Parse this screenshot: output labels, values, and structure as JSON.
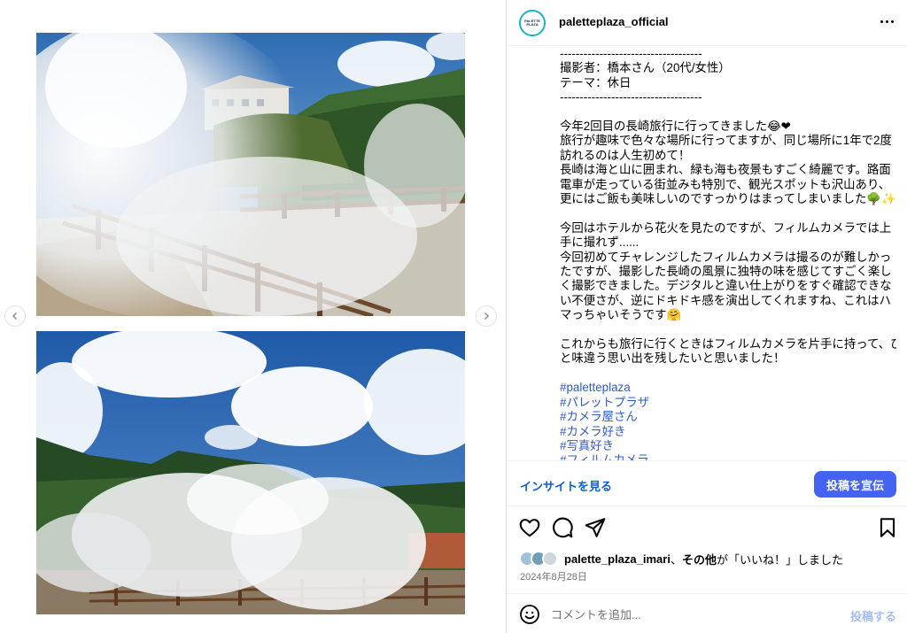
{
  "post": {
    "username": "paletteplaza_official",
    "avatar_text": "PALETTE PLAZA",
    "caption_lines": [
      "------------------------------------",
      "撮影者：橋本さん（20代/女性）",
      "テーマ：休日",
      "------------------------------------",
      "",
      "今年2回目の長崎旅行に行ってきました😂❤",
      "旅行が趣味で色々な場所に行ってますが、同じ場所に1年で2度",
      "訪れるのは人生初めて！",
      "長崎は海と山に囲まれ、緑も海も夜景もすごく綺麗です。路面",
      "電車が走っている街並みも特別で、観光スポットも沢山あり、",
      "更にはご飯も美味しいのですっかりはまってしまいました🌳✨",
      "",
      "今回はホテルから花火を見たのですが、フィルムカメラでは上",
      "手に撮れず......",
      "今回初めてチャレンジしたフィルムカメラは撮るのが難しかっ",
      "たですが、撮影した長崎の風景に独特の味を感じてすごく楽し",
      "く撮影できました。デジタルと違い仕上がりをすぐ確認できな",
      "い不便さが、逆にドキドキ感を演出してくれますね、これはハ",
      "マっちゃいそうです🤗",
      "",
      "これからも旅行に行くときはフィルムカメラを片手に持って、ひ",
      "と味違う思い出を残したいと思いました！",
      ""
    ],
    "hashtags": [
      "#paletteplaza",
      "#パレットプラザ",
      "#カメラ屋さん",
      "#カメラ好き",
      "#写真好き",
      "#フィルムカメラ"
    ],
    "insights_label": "インサイトを見る",
    "promote_label": "投稿を宣伝",
    "likes": {
      "user": "palette_plaza_imari",
      "connector": "、",
      "others": "その他",
      "suffix": "が「いいね！」しました"
    },
    "date": "2024年8月28日",
    "comment_placeholder": "コメントを追加...",
    "post_label": "投稿する"
  },
  "icons": {
    "more": "more-horizontal-icon",
    "like": "heart-icon",
    "comment": "comment-icon",
    "share": "send-icon",
    "save": "bookmark-icon",
    "emoji": "smile-icon",
    "prev": "chevron-left-icon",
    "next": "chevron-right-icon"
  },
  "colors": {
    "accent": "#4463f3",
    "link": "#0a5fd6",
    "hashtag": "#2e5bd1",
    "avatar_ring": "#19b4c8"
  }
}
